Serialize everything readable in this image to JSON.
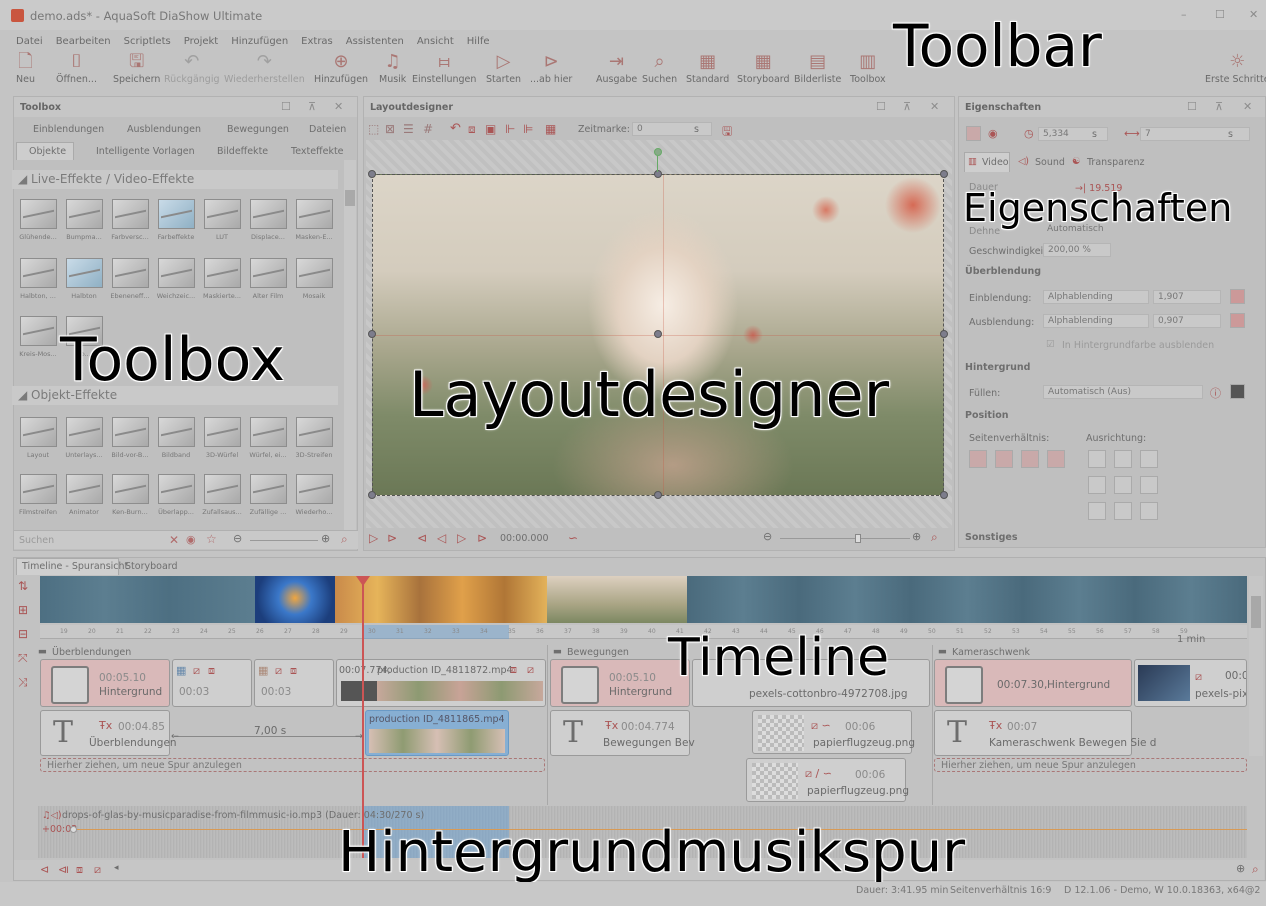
{
  "window": {
    "title": "demo.ads* - AquaSoft DiaShow Ultimate",
    "min": "–",
    "max": "☐",
    "close": "✕"
  },
  "menu": [
    "Datei",
    "Bearbeiten",
    "Scriptlets",
    "Projekt",
    "Hinzufügen",
    "Extras",
    "Assistenten",
    "Ansicht",
    "Hilfe"
  ],
  "toolbar": [
    {
      "label": "Neu",
      "icon": "new-file-icon",
      "glyph": "🗋",
      "enabled": true
    },
    {
      "label": "Öffnen...",
      "icon": "open-icon",
      "glyph": "⌷",
      "enabled": true
    },
    {
      "label": "Speichern",
      "icon": "save-icon",
      "glyph": "🖫",
      "enabled": true
    },
    {
      "label": "Rückgängig",
      "icon": "undo-icon",
      "glyph": "↶",
      "enabled": false
    },
    {
      "label": "Wiederherstellen",
      "icon": "redo-icon",
      "glyph": "↷",
      "enabled": false
    },
    {
      "label": "Hinzufügen",
      "icon": "add-icon",
      "glyph": "⊕",
      "enabled": true
    },
    {
      "label": "Musik",
      "icon": "music-icon",
      "glyph": "♫",
      "enabled": true
    },
    {
      "label": "Einstellungen",
      "icon": "settings-icon",
      "glyph": "⧦",
      "enabled": true
    },
    {
      "label": "Starten",
      "icon": "play-icon",
      "glyph": "▷",
      "enabled": true
    },
    {
      "label": "...ab hier",
      "icon": "play-from-here-icon",
      "glyph": "⊳",
      "enabled": true
    },
    {
      "label": "Ausgabe",
      "icon": "export-icon",
      "glyph": "⇥",
      "enabled": true
    },
    {
      "label": "Suchen",
      "icon": "search-icon",
      "glyph": "⌕",
      "enabled": true
    },
    {
      "label": "Standard",
      "icon": "layout-standard-icon",
      "glyph": "▦",
      "enabled": true
    },
    {
      "label": "Storyboard",
      "icon": "storyboard-icon",
      "glyph": "▦",
      "enabled": true
    },
    {
      "label": "Bilderliste",
      "icon": "image-list-icon",
      "glyph": "▤",
      "enabled": true
    },
    {
      "label": "Toolbox",
      "icon": "toolbox-icon",
      "glyph": "▥",
      "enabled": true
    },
    {
      "label": "Erste Schritte",
      "icon": "lightbulb-icon",
      "glyph": "☼",
      "enabled": true
    }
  ],
  "overlays": {
    "toolbar": "Toolbar",
    "toolbox": "Toolbox",
    "layoutdesigner": "Layoutdesigner",
    "eigenschaften": "Eigenschaften",
    "timeline": "Timeline",
    "music": "Hintergrundmusikspur"
  },
  "toolbox": {
    "title": "Toolbox",
    "tabs_top": [
      "Einblendungen",
      "Ausblendungen",
      "Bewegungen",
      "Dateien"
    ],
    "tabs_bottom": [
      "Objekte",
      "Intelligente Vorlagen",
      "Bildeffekte",
      "Texteffekte"
    ],
    "sections": [
      "Live-Effekte / Video-Effekte",
      "Objekt-Effekte"
    ],
    "row1": [
      "Glühende...",
      "Bumpma...",
      "Farbversc...",
      "Farbeffekte",
      "LUT",
      "Displace...",
      "Masken-E..."
    ],
    "row2": [
      "Halbton, ...",
      "Halbton",
      "Ebeneneff...",
      "Weichzeic...",
      "Maskierte...",
      "Alter Film",
      "Mosaik"
    ],
    "row3": [
      "Kreis-Mos...",
      "Fo..."
    ],
    "row4": [
      "Layout",
      "Unterlays...",
      "Bild-vor-B...",
      "Bildband",
      "3D-Würfel",
      "Würfel, ei...",
      "3D-Streifen"
    ],
    "row5": [
      "Filmstreifen",
      "Animator",
      "Ken-Burn...",
      "Überlapp...",
      "Zufallsaus...",
      "Zufällige ...",
      "Wiederho..."
    ],
    "search_placeholder": "Suchen"
  },
  "layout": {
    "title": "Layoutdesigner",
    "zeitmarke_label": "Zeitmarke:",
    "zeitmarke_value": "0",
    "unit": "s",
    "time": "00:00.000"
  },
  "props": {
    "title": "Eigenschaften",
    "duration": "5,334",
    "unit": "s",
    "dur2": "7",
    "tabs": [
      "Video",
      "Sound",
      "Transparenz"
    ],
    "dauer_label": "Dauer",
    "dauer_value": "→| 19.519",
    "dehne_label": "Dehne",
    "dehne_value": "Automatisch",
    "speed_label": "Geschwindigkeit:",
    "speed_value": "200,00 %",
    "ueberblendung": "Überblendung",
    "ein_label": "Einblendung:",
    "ein_value": "Alphablending",
    "ein_time": "1,907",
    "aus_label": "Ausblendung:",
    "aus_value": "Alphablending",
    "aus_time": "0,907",
    "hintergrundfarbe": "In Hintergrundfarbe ausblenden",
    "hintergrund": "Hintergrund",
    "fuellen_label": "Füllen:",
    "fuellen_value": "Automatisch (Aus)",
    "position": "Position",
    "seiten": "Seitenverhältnis:",
    "ausrichtung": "Ausrichtung:",
    "sonstiges": "Sonstiges"
  },
  "timeline": {
    "tabs": [
      "Timeline - Spuransicht",
      "Storyboard"
    ],
    "ruler": [
      "19",
      "20",
      "21",
      "22",
      "23",
      "24",
      "25",
      "26",
      "27",
      "28",
      "29",
      "30",
      "31",
      "32",
      "33",
      "34",
      "35",
      "36",
      "37",
      "38",
      "39",
      "40",
      "41",
      "42",
      "43",
      "44",
      "45",
      "46",
      "47",
      "48",
      "49",
      "50",
      "51",
      "52",
      "53",
      "54",
      "55",
      "56",
      "57",
      "58",
      "59",
      "1 min"
    ],
    "groups": [
      "Überblendungen",
      "Bewegungen",
      "Kameraschwenk"
    ],
    "clips": {
      "c1_time": "00:05.10",
      "c1_name": "Hintergrund",
      "c2_time": "00:03",
      "c3_time": "00:03",
      "c4_time": "00:07.774,",
      "c4_name": "production ID_4811872.mp4",
      "c5_time": "00:05.10",
      "c5_name": "Hintergrund",
      "c6_name": "pexels-cottonbro-4972708.jpg",
      "c7_time": "00:07.30,",
      "c7_name": "Hintergrund",
      "c8_time": "00:0",
      "c8_name": "pexels-pixa",
      "t1_time": "00:04.85",
      "t1_name": "Überblendungen",
      "gap": "7,00 s",
      "v2_name": "production ID_4811865.mp4",
      "t2_time": "00:04.774",
      "t2_name": "Bewegungen Bev",
      "p1_time": "00:06",
      "p1_name": "papierflugzeug.png",
      "p2_time": "00:06",
      "p2_name": "papierflugzeug.png",
      "t3_time": "00:07",
      "t3_name": "Kameraschwenk Bewegen Sie d"
    },
    "dropzone": "Hierher ziehen, um neue Spur anzulegen"
  },
  "music": {
    "file": "drops-of-glas-by-musicparadise-from-filmmusic-io.mp3 (Dauer: 04:30/270 s)",
    "offset": "+00:02"
  },
  "status": {
    "dauer": "Dauer: 3:41.95 min",
    "seiten": "Seitenverhältnis 16:9",
    "version": "D 12.1.06 - Demo, W 10.0.18363, x64@2"
  }
}
